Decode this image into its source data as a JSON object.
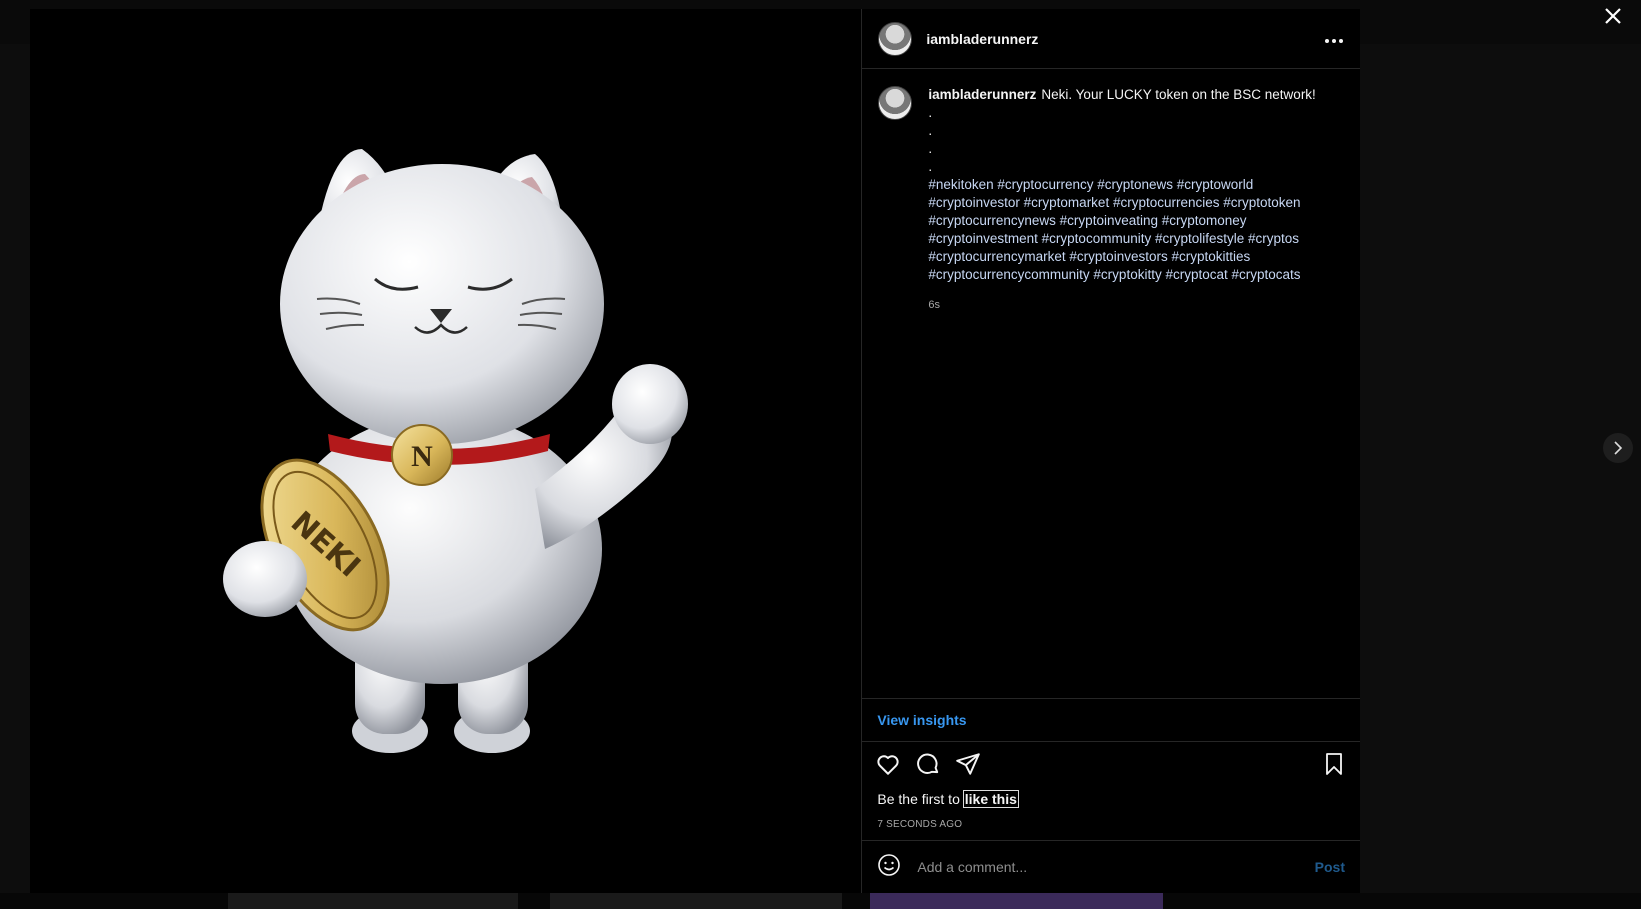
{
  "post": {
    "username": "iambladerunnerz",
    "more_icon": "more-horizontal-icon",
    "caption": {
      "username": "iambladerunnerz",
      "text": "Neki. Your LUCKY token on the BSC network!",
      "dots": [
        ".",
        ".",
        ".",
        "."
      ],
      "hashtags": "#nekitoken #cryptocurrency #cryptonews #cryptoworld #cryptoinvestor #cryptomarket #cryptocurrencies #cryptotoken #cryptocurrencynews #cryptoinveating #cryptomoney #cryptoinvestment #cryptocommunity #cryptolifestyle #cryptos #cryptocurrencymarket #cryptoinvestors #cryptokitties #cryptocurrencycommunity #cryptokitty #cryptocat #cryptocats",
      "time": "6s"
    },
    "view_insights": "View insights",
    "likes_prefix": "Be the first to ",
    "likes_link": "like this",
    "posted_ago": "7 SECONDS AGO",
    "comment_placeholder": "Add a comment...",
    "post_button": "Post"
  },
  "media": {
    "badge_letter": "N",
    "token_text": "NEKI"
  },
  "icons": {
    "close": "close-icon",
    "next": "chevron-right-icon",
    "like": "heart-icon",
    "comment": "comment-icon",
    "share": "share-icon",
    "save": "bookmark-icon",
    "emoji": "emoji-icon"
  },
  "colors": {
    "link": "#3897f0",
    "hashtag": "#c7d7f3",
    "collar": "#b3191b"
  }
}
